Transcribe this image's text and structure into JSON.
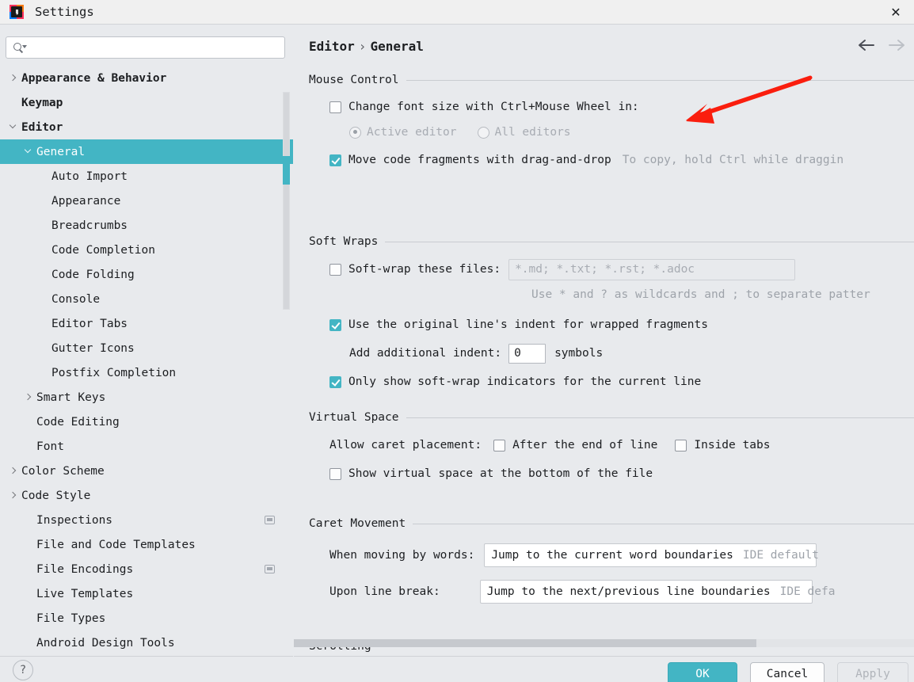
{
  "window": {
    "title": "Settings",
    "app_icon": "intellij-idea-icon",
    "close_label": "✕"
  },
  "search": {
    "value": "",
    "placeholder": "",
    "icon": "search-icon"
  },
  "sidebar": {
    "items": [
      {
        "label": "Appearance & Behavior",
        "indent": 0,
        "arrow": "right",
        "bold": true,
        "selected": false,
        "scope_icon": false
      },
      {
        "label": "Keymap",
        "indent": 0,
        "arrow": "none",
        "bold": true,
        "selected": false,
        "scope_icon": false
      },
      {
        "label": "Editor",
        "indent": 0,
        "arrow": "down",
        "bold": true,
        "selected": false,
        "scope_icon": false
      },
      {
        "label": "General",
        "indent": 1,
        "arrow": "down",
        "bold": false,
        "selected": true,
        "scope_icon": false
      },
      {
        "label": "Auto Import",
        "indent": 2,
        "arrow": "none",
        "bold": false,
        "selected": false,
        "scope_icon": false
      },
      {
        "label": "Appearance",
        "indent": 2,
        "arrow": "none",
        "bold": false,
        "selected": false,
        "scope_icon": false
      },
      {
        "label": "Breadcrumbs",
        "indent": 2,
        "arrow": "none",
        "bold": false,
        "selected": false,
        "scope_icon": false
      },
      {
        "label": "Code Completion",
        "indent": 2,
        "arrow": "none",
        "bold": false,
        "selected": false,
        "scope_icon": false
      },
      {
        "label": "Code Folding",
        "indent": 2,
        "arrow": "none",
        "bold": false,
        "selected": false,
        "scope_icon": false
      },
      {
        "label": "Console",
        "indent": 2,
        "arrow": "none",
        "bold": false,
        "selected": false,
        "scope_icon": false
      },
      {
        "label": "Editor Tabs",
        "indent": 2,
        "arrow": "none",
        "bold": false,
        "selected": false,
        "scope_icon": false
      },
      {
        "label": "Gutter Icons",
        "indent": 2,
        "arrow": "none",
        "bold": false,
        "selected": false,
        "scope_icon": false
      },
      {
        "label": "Postfix Completion",
        "indent": 2,
        "arrow": "none",
        "bold": false,
        "selected": false,
        "scope_icon": false
      },
      {
        "label": "Smart Keys",
        "indent": 1,
        "arrow": "right",
        "bold": false,
        "selected": false,
        "scope_icon": false
      },
      {
        "label": "Code Editing",
        "indent": 1,
        "arrow": "none",
        "bold": false,
        "selected": false,
        "scope_icon": false
      },
      {
        "label": "Font",
        "indent": 1,
        "arrow": "none",
        "bold": false,
        "selected": false,
        "scope_icon": false
      },
      {
        "label": "Color Scheme",
        "indent": 0,
        "arrow": "right",
        "bold": false,
        "selected": false,
        "scope_icon": false
      },
      {
        "label": "Code Style",
        "indent": 0,
        "arrow": "right",
        "bold": false,
        "selected": false,
        "scope_icon": false
      },
      {
        "label": "Inspections",
        "indent": 1,
        "arrow": "none",
        "bold": false,
        "selected": false,
        "scope_icon": true
      },
      {
        "label": "File and Code Templates",
        "indent": 1,
        "arrow": "none",
        "bold": false,
        "selected": false,
        "scope_icon": false
      },
      {
        "label": "File Encodings",
        "indent": 1,
        "arrow": "none",
        "bold": false,
        "selected": false,
        "scope_icon": true
      },
      {
        "label": "Live Templates",
        "indent": 1,
        "arrow": "none",
        "bold": false,
        "selected": false,
        "scope_icon": false
      },
      {
        "label": "File Types",
        "indent": 1,
        "arrow": "none",
        "bold": false,
        "selected": false,
        "scope_icon": false
      },
      {
        "label": "Android Design Tools",
        "indent": 1,
        "arrow": "none",
        "bold": false,
        "selected": false,
        "scope_icon": false
      }
    ]
  },
  "breadcrumb": {
    "root": "Editor",
    "separator": "›",
    "leaf": "General"
  },
  "nav": {
    "back": "back-arrow",
    "forward": "forward-arrow"
  },
  "main": {
    "mouse_control": {
      "title": "Mouse Control",
      "change_font_size": {
        "label": "Change font size with Ctrl+Mouse Wheel in:",
        "checked": false
      },
      "radio_active_editor": {
        "label": "Active editor",
        "selected": true,
        "disabled": true
      },
      "radio_all_editors": {
        "label": "All editors",
        "selected": false,
        "disabled": true
      },
      "move_code_fragments": {
        "label": "Move code fragments with drag-and-drop",
        "checked": true,
        "hint": "To copy, hold Ctrl while draggin"
      }
    },
    "soft_wraps": {
      "title": "Soft Wraps",
      "soft_wrap_files": {
        "label": "Soft-wrap these files:",
        "checked": false,
        "value": "*.md; *.txt; *.rst; *.adoc"
      },
      "wildcard_hint": "Use * and ? as wildcards and ; to separate patter",
      "use_original_indent": {
        "label": "Use the original line's indent for wrapped fragments",
        "checked": true
      },
      "additional_indent": {
        "label": "Add additional indent:",
        "value": "0",
        "suffix": "symbols"
      },
      "only_show_indicators": {
        "label": "Only show soft-wrap indicators for the current line",
        "checked": true
      }
    },
    "virtual_space": {
      "title": "Virtual Space",
      "allow_caret_label": "Allow caret placement:",
      "after_end_of_line": {
        "label": "After the end of line",
        "checked": false
      },
      "inside_tabs": {
        "label": "Inside tabs",
        "checked": false
      },
      "show_virtual_space": {
        "label": "Show virtual space at the bottom of the file",
        "checked": false
      }
    },
    "caret_movement": {
      "title": "Caret Movement",
      "when_moving_by_words": {
        "label": "When moving by words:",
        "value": "Jump to the current word boundaries",
        "badge": "IDE default"
      },
      "upon_line_break": {
        "label": "Upon line break:",
        "value": "Jump to the next/previous line boundaries",
        "badge": "IDE defa"
      }
    },
    "scrolling": {
      "title": "Scrolling"
    }
  },
  "footer": {
    "help": "?",
    "ok": "OK",
    "cancel": "Cancel",
    "apply": "Apply"
  },
  "annotation": {
    "type": "red-arrow",
    "color": "#fa1e0e"
  },
  "colors": {
    "accent": "#43b5c4",
    "background": "#e8eaed",
    "text": "#1c1e21",
    "muted": "#9ea3aa",
    "annotation_red": "#fa1e0e"
  }
}
